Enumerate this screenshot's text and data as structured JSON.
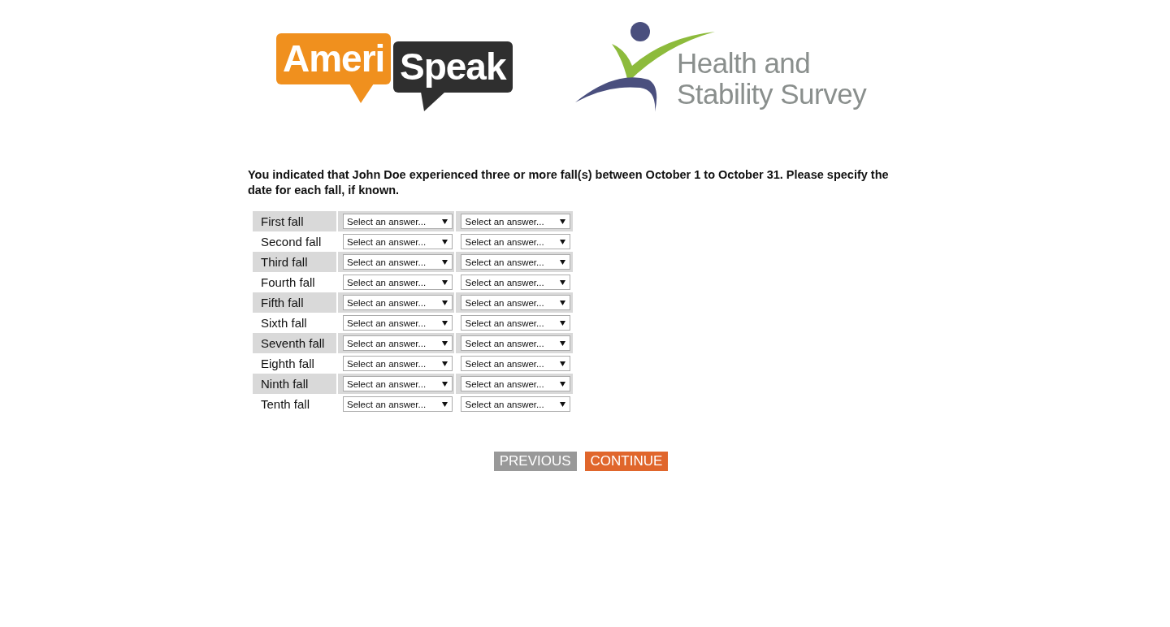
{
  "logos": {
    "amerispeak": [
      "Ameri",
      "Speak"
    ],
    "survey": [
      "Health and",
      "Stability Survey"
    ]
  },
  "question": "You indicated that John Doe experienced three or more fall(s) between October 1 to October 31. Please specify the date for each fall, if known.",
  "rows": [
    {
      "label": "First fall",
      "selects": [
        "Select an answer...",
        "Select an answer..."
      ]
    },
    {
      "label": "Second fall",
      "selects": [
        "Select an answer...",
        "Select an answer..."
      ]
    },
    {
      "label": "Third fall",
      "selects": [
        "Select an answer...",
        "Select an answer..."
      ]
    },
    {
      "label": "Fourth fall",
      "selects": [
        "Select an answer...",
        "Select an answer..."
      ]
    },
    {
      "label": "Fifth fall",
      "selects": [
        "Select an answer...",
        "Select an answer..."
      ]
    },
    {
      "label": "Sixth fall",
      "selects": [
        "Select an answer...",
        "Select an answer..."
      ]
    },
    {
      "label": "Seventh fall",
      "selects": [
        "Select an answer...",
        "Select an answer..."
      ]
    },
    {
      "label": "Eighth fall",
      "selects": [
        "Select an answer...",
        "Select an answer..."
      ]
    },
    {
      "label": "Ninth fall",
      "selects": [
        "Select an answer...",
        "Select an answer..."
      ]
    },
    {
      "label": "Tenth fall",
      "selects": [
        "Select an answer...",
        "Select an answer..."
      ]
    }
  ],
  "buttons": [
    {
      "label": "PREVIOUS",
      "kind": "back"
    },
    {
      "label": "CONTINUE",
      "kind": "next"
    }
  ]
}
